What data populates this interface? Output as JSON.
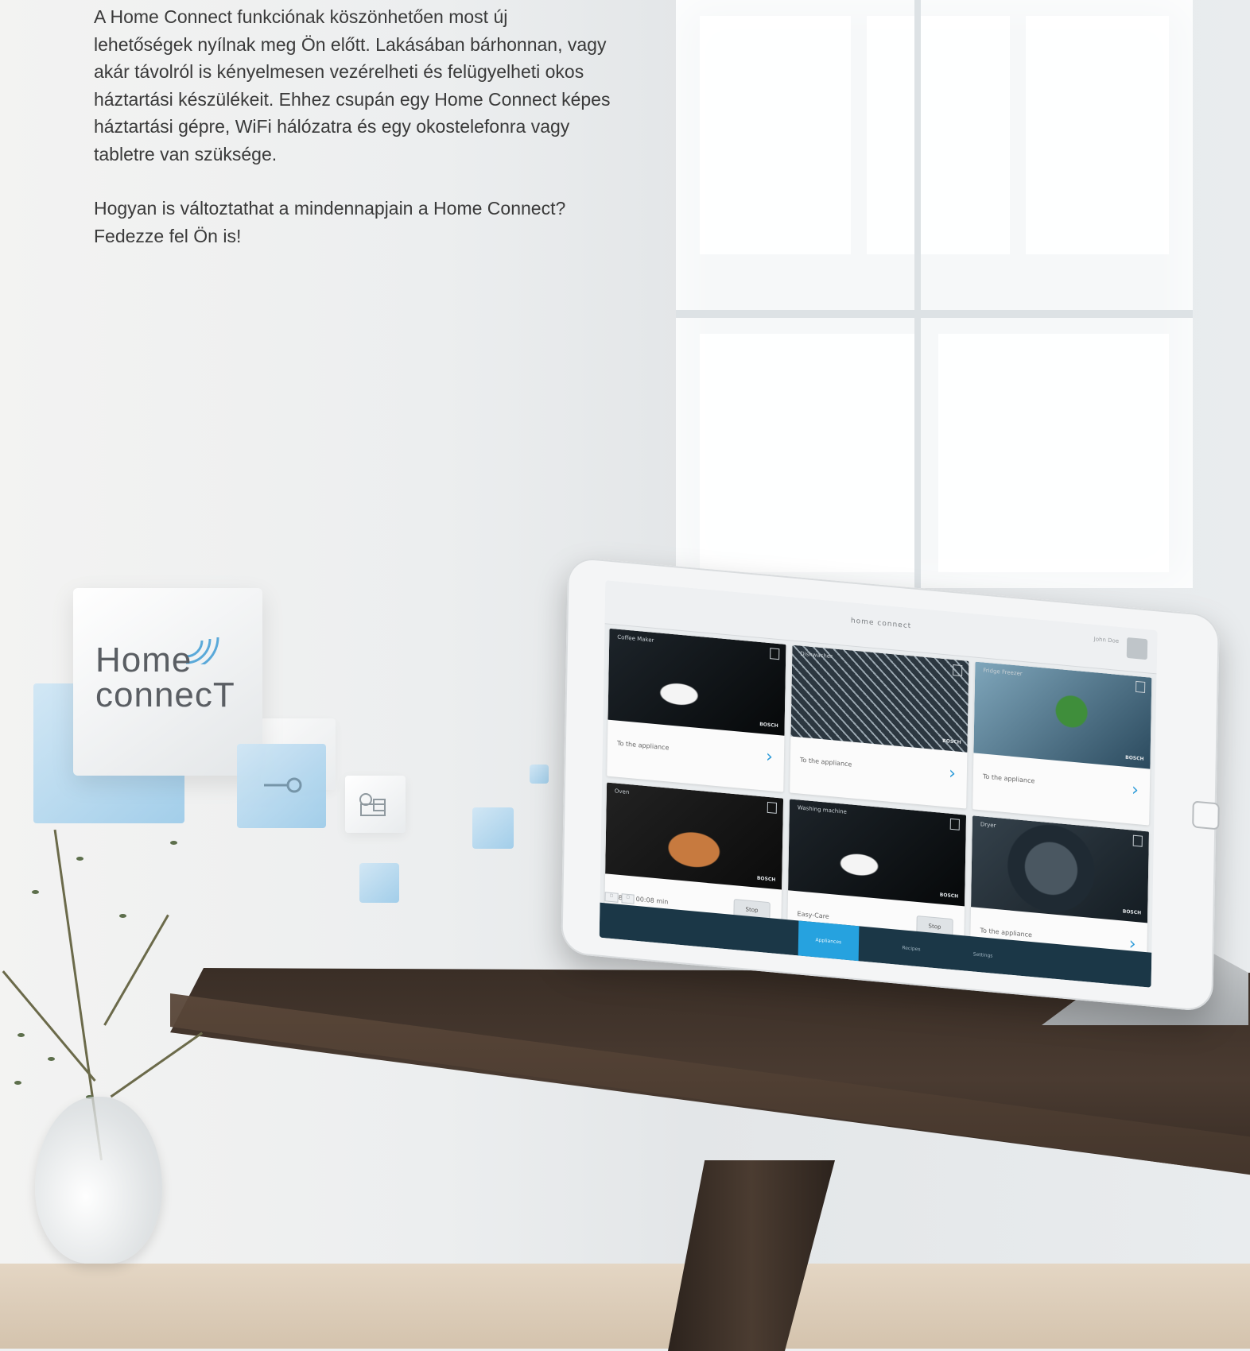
{
  "intro": {
    "paragraph1": "A Home Connect funkciónak köszönhetően most új lehetőségek nyílnak meg Ön előtt. Lakásában bárhonnan, vagy akár távolról is kényelmesen vezérelheti és felügyelheti okos háztartási készülékeit. Ehhez csupán egy Home Connect képes háztartási gépre, WiFi hálózatra és egy okostelefonra vagy tabletre van szüksége.",
    "paragraph2": "Hogyan is változtathat a mindennapjain a Home Connect? Fedezze fel Ön is!"
  },
  "logo": {
    "line1": "Home",
    "line2": "connecT"
  },
  "tablet": {
    "app_logo": "home connect",
    "user_name": "John Doe",
    "cards": [
      {
        "title": "Coffee Maker",
        "footer": "To the appliance",
        "action": "chevron",
        "brand": "BOSCH",
        "image": "cup"
      },
      {
        "title": "Dishwasher",
        "footer": "To the appliance",
        "action": "chevron",
        "brand": "BOSCH",
        "image": "dish"
      },
      {
        "title": "Fridge Freezer",
        "footer": "To the appliance",
        "action": "chevron",
        "brand": "BOSCH",
        "image": "green"
      },
      {
        "title": "Oven",
        "footer": "180° | 00:08 min",
        "action": "Stop",
        "brand": "BOSCH",
        "image": "oven"
      },
      {
        "title": "Washing machine",
        "footer": "Easy-Care",
        "action": "Stop",
        "brand": "BOSCH",
        "image": "cup"
      },
      {
        "title": "Dryer",
        "footer": "To the appliance",
        "action": "chevron",
        "brand": "BOSCH",
        "image": "washer"
      }
    ],
    "tabs": [
      "Appliances",
      "Recipes",
      "Settings"
    ],
    "active_tab": 0
  },
  "colors": {
    "accent": "#26a2df",
    "tabbar": "#1b3747",
    "tile_blue": "#9ccbe9",
    "table": "#3a2e26"
  }
}
